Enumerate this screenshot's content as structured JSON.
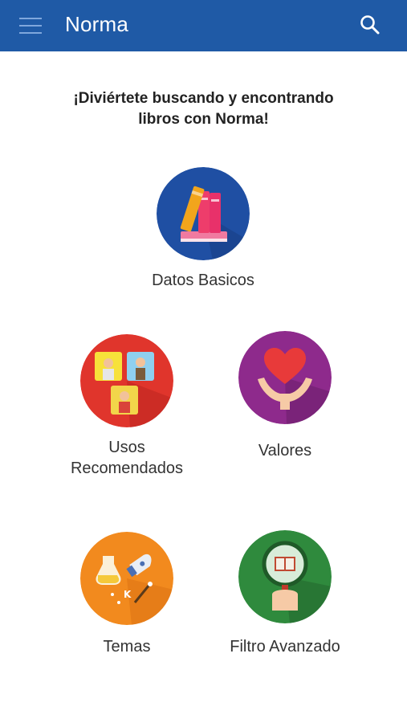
{
  "app": {
    "title": "Norma"
  },
  "welcome": {
    "line1": "¡Diviértete buscando y encontrando",
    "line2": "libros con Norma!"
  },
  "tiles": [
    {
      "label": "Datos Basicos",
      "icon": "books-icon",
      "color": "#1f5aa6"
    },
    {
      "label_line1": "Usos",
      "label_line2": "Recomendados",
      "icon": "people-cards-icon",
      "color": "#e0392f"
    },
    {
      "label": "Valores",
      "icon": "heart-hands-icon",
      "color": "#8e2a8c"
    },
    {
      "label": "Temas",
      "icon": "science-rocket-icon",
      "color": "#f08a1f"
    },
    {
      "label": "Filtro Avanzado",
      "icon": "magnifier-book-icon",
      "color": "#2f8a3d"
    }
  ],
  "colors": {
    "appbar": "#1f5aa6",
    "text": "#333333"
  }
}
